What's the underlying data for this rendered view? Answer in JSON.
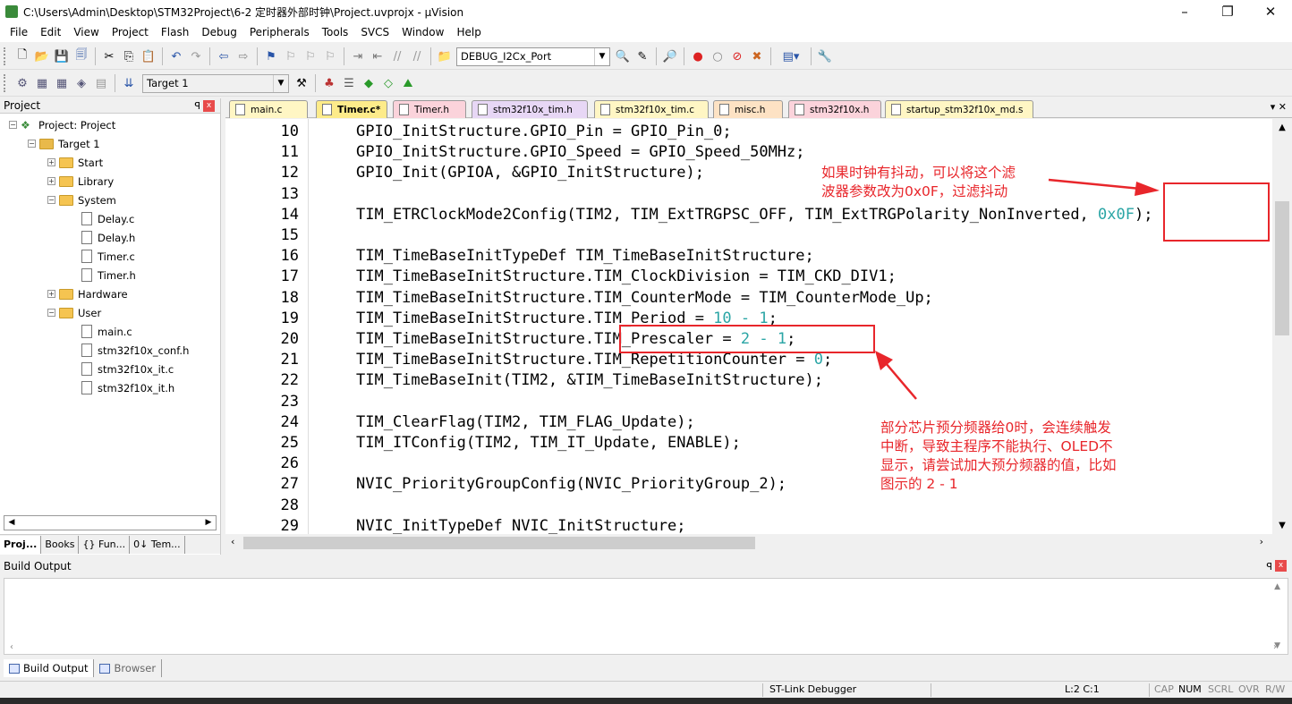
{
  "window": {
    "title": "C:\\Users\\Admin\\Desktop\\STM32Project\\6-2 定时器外部时钟\\Project.uvprojx - µVision",
    "minimize": "–",
    "restore": "❐",
    "close": "✕"
  },
  "menu": [
    "File",
    "Edit",
    "View",
    "Project",
    "Flash",
    "Debug",
    "Peripherals",
    "Tools",
    "SVCS",
    "Window",
    "Help"
  ],
  "toolbar": {
    "config_combo": "DEBUG_I2Cx_Port",
    "target_combo": "Target 1"
  },
  "project_panel": {
    "title": "Project",
    "pin": "ᴘ",
    "close": "x",
    "tree": {
      "root": "Project: Project",
      "target": "Target 1",
      "start": "Start",
      "library": "Library",
      "system": "System",
      "delay_c": "Delay.c",
      "delay_h": "Delay.h",
      "timer_c": "Timer.c",
      "timer_h": "Timer.h",
      "hardware": "Hardware",
      "user": "User",
      "main_c": "main.c",
      "conf_h": "stm32f10x_conf.h",
      "it_c": "stm32f10x_it.c",
      "it_h": "stm32f10x_it.h"
    },
    "tabs": [
      "Proj...",
      "Books",
      "{} Fun...",
      "0↓ Tem..."
    ]
  },
  "editor_tabs": [
    "main.c",
    "Timer.c*",
    "Timer.h",
    "stm32f10x_tim.h",
    "stm32f10x_tim.c",
    "misc.h",
    "stm32f10x.h",
    "startup_stm32f10x_md.s"
  ],
  "code": [
    {
      "n": "10",
      "t": "GPIO_InitStructure.GPIO_Pin = GPIO_Pin_0;"
    },
    {
      "n": "11",
      "t": "GPIO_InitStructure.GPIO_Speed = GPIO_Speed_50MHz;"
    },
    {
      "n": "12",
      "t": "GPIO_Init(GPIOA, &GPIO_InitStructure);"
    },
    {
      "n": "13",
      "t": ""
    },
    {
      "n": "14",
      "t": "TIM_ETRClockMode2Config(TIM2, TIM_ExtTRGPSC_OFF, TIM_ExtTRGPolarity_NonInverted, ",
      "num": "0x0F",
      "tail": ");"
    },
    {
      "n": "15",
      "t": ""
    },
    {
      "n": "16",
      "t": "TIM_TimeBaseInitTypeDef TIM_TimeBaseInitStructure;"
    },
    {
      "n": "17",
      "t": "TIM_TimeBaseInitStructure.TIM_ClockDivision = TIM_CKD_DIV1;"
    },
    {
      "n": "18",
      "t": "TIM_TimeBaseInitStructure.TIM_CounterMode = TIM_CounterMode_Up;"
    },
    {
      "n": "19",
      "t": "TIM_TimeBaseInitStructure.TIM_Period = ",
      "num": "10 - 1",
      "tail": ";"
    },
    {
      "n": "20",
      "t": "TIM_TimeBaseInitStructure.TIM_Prescaler = ",
      "num": "2 - 1",
      "tail": ";"
    },
    {
      "n": "21",
      "t": "TIM_TimeBaseInitStructure.TIM_RepetitionCounter = ",
      "num": "0",
      "tail": ";"
    },
    {
      "n": "22",
      "t": "TIM_TimeBaseInit(TIM2, &TIM_TimeBaseInitStructure);"
    },
    {
      "n": "23",
      "t": ""
    },
    {
      "n": "24",
      "t": "TIM_ClearFlag(TIM2, TIM_FLAG_Update);"
    },
    {
      "n": "25",
      "t": "TIM_ITConfig(TIM2, TIM_IT_Update, ENABLE);"
    },
    {
      "n": "26",
      "t": ""
    },
    {
      "n": "27",
      "t": "NVIC_PriorityGroupConfig(NVIC_PriorityGroup_2);"
    },
    {
      "n": "28",
      "t": ""
    },
    {
      "n": "29",
      "t": "NVIC_InitTypeDef NVIC_InitStructure;"
    }
  ],
  "annotations": {
    "filter_note": "如果时钟有抖动，可以将这个滤\n波器参数改为0x0F，过滤抖动",
    "prescaler_note": "部分芯片预分频器给0时，会连续触发\n中断，导致主程序不能执行、OLED不\n显示，请尝试加大预分频器的值，比如\n图示的 2 - 1"
  },
  "build": {
    "title": "Build Output",
    "tabs": [
      "Build Output",
      "Browser"
    ]
  },
  "status": {
    "debugger": "ST-Link Debugger",
    "position": "L:2 C:1",
    "cap": "CAP",
    "num": "NUM",
    "scrl": "SCRL",
    "ovr": "OVR",
    "rw": "R/W"
  },
  "colors": {
    "accent_red": "#e8262b",
    "number": "#2aa5a5"
  }
}
